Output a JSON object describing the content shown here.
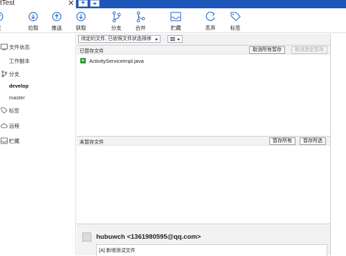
{
  "window": {
    "tab_title": "tTest",
    "close_glyph": "✕",
    "new_tab_glyph": "+"
  },
  "toolbar": {
    "items": [
      {
        "label": "交",
        "icon": "commit-icon"
      },
      {
        "label": "拉取",
        "icon": "pull-icon"
      },
      {
        "label": "推送",
        "icon": "push-icon"
      },
      {
        "label": "获取",
        "icon": "fetch-icon"
      },
      {
        "label": "分支",
        "icon": "branch-icon"
      },
      {
        "label": "合并",
        "icon": "merge-icon"
      },
      {
        "label": "贮藏",
        "icon": "stash-icon"
      },
      {
        "label": "丢弃",
        "icon": "discard-icon"
      },
      {
        "label": "标签",
        "icon": "tag-icon"
      }
    ]
  },
  "sidebar": {
    "file_status": {
      "label": "文件状态",
      "icon": "file-status-icon"
    },
    "working_copy": "工作副本",
    "branches": {
      "label": "分支",
      "icon": "branch-icon"
    },
    "branch_items": [
      "develop",
      "master"
    ],
    "tags": {
      "label": "标签",
      "icon": "tag-icon"
    },
    "remotes": {
      "label": "远程",
      "icon": "cloud-icon"
    },
    "stashes": {
      "label": "贮藏",
      "icon": "stash-icon"
    }
  },
  "filter": {
    "sort_selected": "待定的文件, 已依照文件状态排序"
  },
  "staged": {
    "title": "已暂存文件",
    "unstage_all": "取消所有暂存",
    "unstage_selected": "取消选定暂存",
    "files": [
      {
        "name": "ActivityServiceImpl.java",
        "status": "added"
      }
    ]
  },
  "unstaged": {
    "title": "未暂存文件",
    "stage_all": "暂存所有",
    "stage_selected": "暂存所选"
  },
  "commit": {
    "author": "hubuwch <1361980595@qq.com>",
    "message": "[A] 新增测试文件"
  },
  "colors": {
    "accent": "#1c56b8",
    "icon_blue": "#2b73c9",
    "add_green": "#2c9a2c"
  }
}
